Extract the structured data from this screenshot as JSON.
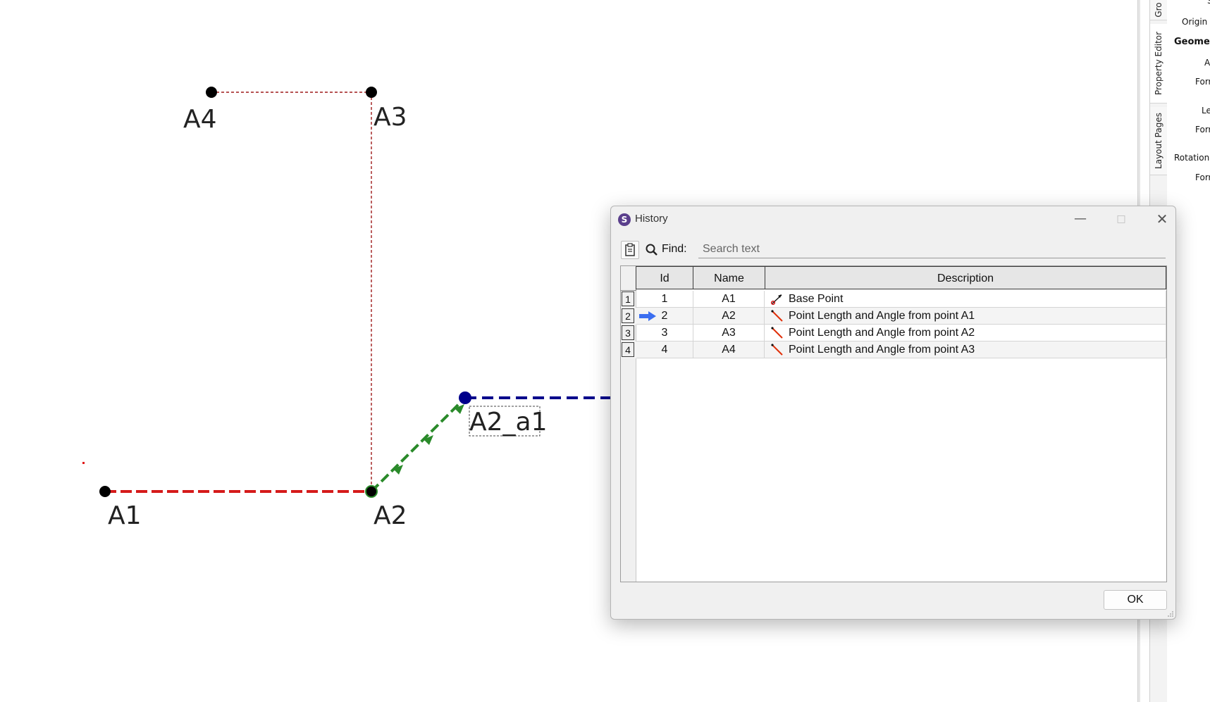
{
  "canvas": {
    "point_labels": {
      "a1": "A1",
      "a2": "A2",
      "a3": "A3",
      "a4": "A4",
      "a2_a1": "A2_a1"
    },
    "colors": {
      "line_a1_a2": "#d51a1a",
      "line_a2_a3_a4": "#9e1a1a",
      "line_green": "#2a8a2a",
      "line_blue": "#00008b",
      "point": "#000000"
    }
  },
  "dock": {
    "tabs": [
      {
        "label": "Gro"
      },
      {
        "label": "Property Editor"
      },
      {
        "label": "Layout Pages"
      }
    ],
    "property_rows": [
      {
        "label": "S"
      },
      {
        "label": "Origin p"
      },
      {
        "label": "Geomet"
      },
      {
        "label": "A"
      },
      {
        "label": "Forr"
      },
      {
        "label": "Le"
      },
      {
        "label": "Forr"
      },
      {
        "label": "Rotation"
      },
      {
        "label": "Forr"
      }
    ]
  },
  "history_dialog": {
    "title": "History",
    "app_icon_letter": "S",
    "find_label": "Find:",
    "search_placeholder": "Search text",
    "columns": {
      "id": "Id",
      "name": "Name",
      "description": "Description"
    },
    "rows": [
      {
        "row_number": "1",
        "id": "1",
        "name": "A1",
        "description": "Base Point",
        "icon": "base-point-icon",
        "current": false
      },
      {
        "row_number": "2",
        "id": "2",
        "name": "A2",
        "description": "Point Length and Angle from point A1",
        "icon": "line-point-icon",
        "current": true
      },
      {
        "row_number": "3",
        "id": "3",
        "name": "A3",
        "description": "Point Length and Angle from point A2",
        "icon": "line-point-icon",
        "current": false
      },
      {
        "row_number": "4",
        "id": "4",
        "name": "A4",
        "description": "Point Length and Angle from point A3",
        "icon": "line-point-icon",
        "current": false
      }
    ],
    "ok_label": "OK",
    "accent_arrow_color": "#3b6ef0"
  }
}
